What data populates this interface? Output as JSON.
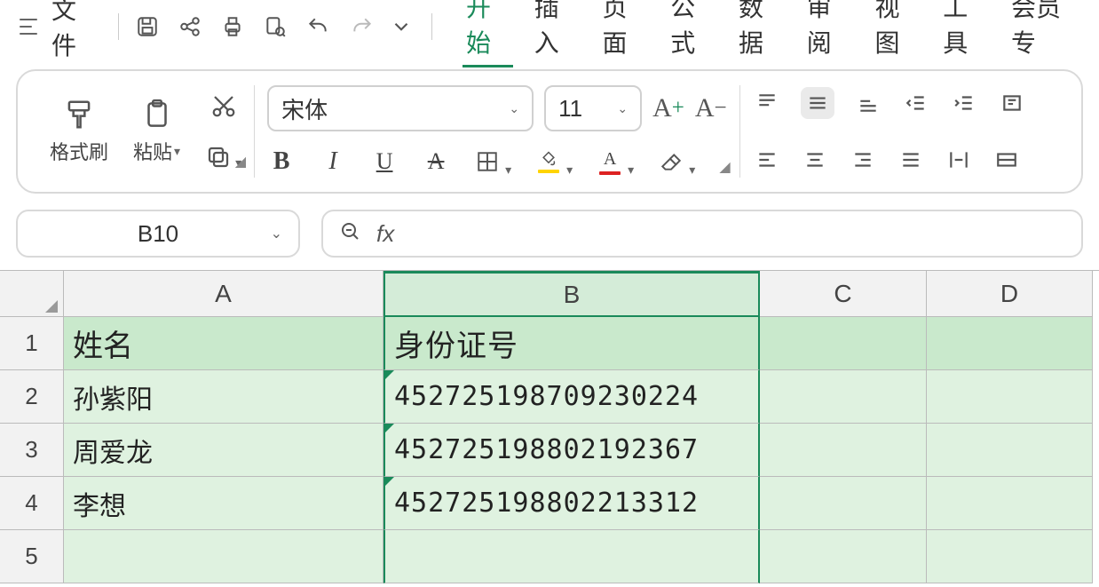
{
  "menu": {
    "file_label": "文件",
    "tabs": [
      "开始",
      "插入",
      "页面",
      "公式",
      "数据",
      "审阅",
      "视图",
      "工具",
      "会员专"
    ],
    "active_tab_index": 0
  },
  "ribbon": {
    "format_painter_label": "格式刷",
    "paste_label": "粘贴",
    "font_name": "宋体",
    "font_size": "11"
  },
  "namebox": {
    "value": "B10"
  },
  "formula": {
    "fx_label": "fx",
    "value": ""
  },
  "sheet": {
    "columns": [
      "A",
      "B",
      "C",
      "D"
    ],
    "selected_column_index": 1,
    "row_count": 5,
    "rows": [
      {
        "A": "姓名",
        "B": "身份证号"
      },
      {
        "A": "孙紫阳",
        "B": "452725198709230224"
      },
      {
        "A": "周爱龙",
        "B": "452725198802192367"
      },
      {
        "A": "李想",
        "B": "452725198802213312"
      },
      {
        "A": "",
        "B": ""
      }
    ]
  }
}
